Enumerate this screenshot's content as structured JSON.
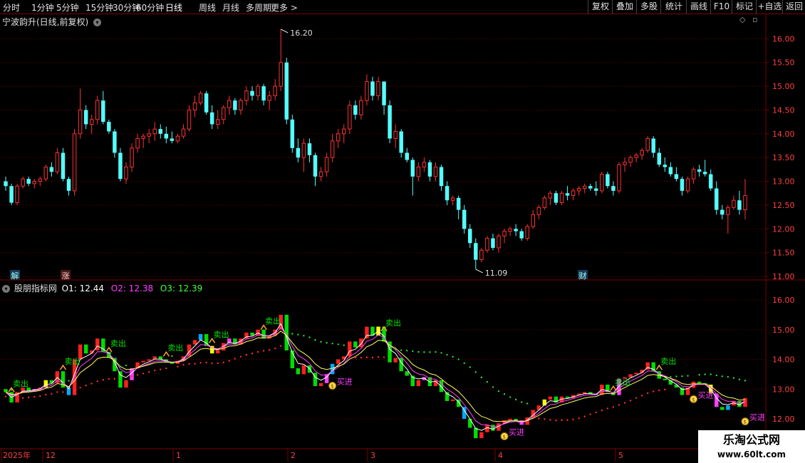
{
  "toolbar": {
    "periods": [
      "分时",
      "1分钟",
      "5分钟",
      "15分钟",
      "30分钟",
      "60分钟",
      "日线",
      "周线",
      "月线",
      "多周期",
      "更多 >"
    ],
    "active_period": "日线",
    "right_buttons": [
      "复权",
      "叠加",
      "多股",
      "统计",
      "画线",
      "F10",
      "标记",
      "+自选",
      "返回"
    ]
  },
  "main_chart": {
    "title": "宁波韵升(日线,前复权)",
    "high_label": "16.20",
    "low_label": "11.09",
    "y_ticks": [
      "16.00",
      "15.50",
      "15.00",
      "14.50",
      "14.00",
      "13.50",
      "13.00",
      "12.50",
      "12.00",
      "11.50",
      "11.00"
    ],
    "markers": [
      "解",
      "涨",
      "财"
    ]
  },
  "sub_chart": {
    "title": "股朋指标网",
    "o1_label": "O1: 12.44",
    "o2_label": "O2: 12.38",
    "o3_label": "O3: 12.39",
    "y_ticks": [
      "16.00",
      "15.00",
      "14.00",
      "13.00",
      "12.00"
    ],
    "buy_label": "买进",
    "sell_label": "卖出"
  },
  "time_axis": {
    "labels": [
      "2025年",
      "12",
      "1",
      "2",
      "3",
      "4",
      "5"
    ]
  },
  "watermark": {
    "line1": "乐淘公式网",
    "line2": "www.60lt.com"
  },
  "colors": {
    "up": "#ff3232",
    "down": "#54ffff",
    "grid": "#7a0000",
    "sell": "#00e000",
    "buy": "#ff40ff"
  },
  "chart_data": {
    "type": "candlestick",
    "ylim": [
      11.0,
      16.2
    ],
    "high": 16.2,
    "low": 11.09,
    "candles": [
      [
        13.0,
        13.1,
        12.8,
        12.9
      ],
      [
        12.9,
        12.95,
        12.5,
        12.55
      ],
      [
        12.55,
        12.95,
        12.5,
        12.9
      ],
      [
        12.9,
        13.1,
        12.85,
        13.05
      ],
      [
        13.05,
        13.1,
        12.9,
        12.95
      ],
      [
        12.95,
        13.05,
        12.85,
        13.0
      ],
      [
        13.0,
        13.1,
        12.9,
        13.05
      ],
      [
        13.05,
        13.35,
        13.0,
        13.3
      ],
      [
        13.3,
        13.4,
        13.1,
        13.2
      ],
      [
        13.2,
        13.7,
        13.15,
        13.6
      ],
      [
        13.6,
        13.7,
        13.0,
        13.05
      ],
      [
        13.05,
        13.1,
        12.7,
        12.8
      ],
      [
        12.8,
        14.1,
        12.7,
        14.0
      ],
      [
        14.0,
        14.95,
        13.9,
        14.5
      ],
      [
        14.5,
        14.6,
        14.1,
        14.2
      ],
      [
        14.2,
        14.4,
        14.0,
        14.3
      ],
      [
        14.3,
        14.8,
        14.2,
        14.7
      ],
      [
        14.7,
        14.9,
        14.2,
        14.25
      ],
      [
        14.25,
        14.3,
        14.0,
        14.05
      ],
      [
        14.05,
        14.1,
        13.5,
        13.6
      ],
      [
        13.6,
        13.7,
        13.0,
        13.05
      ],
      [
        13.05,
        13.4,
        12.95,
        13.3
      ],
      [
        13.3,
        13.8,
        13.2,
        13.7
      ],
      [
        13.7,
        14.0,
        13.6,
        13.9
      ],
      [
        13.9,
        14.0,
        13.7,
        13.95
      ],
      [
        13.95,
        14.1,
        13.8,
        14.0
      ],
      [
        14.0,
        14.25,
        13.85,
        14.1
      ],
      [
        14.1,
        14.2,
        13.9,
        14.0
      ],
      [
        14.0,
        14.15,
        13.8,
        13.9
      ],
      [
        13.9,
        14.05,
        13.8,
        13.85
      ],
      [
        13.85,
        14.0,
        13.8,
        13.95
      ],
      [
        13.95,
        14.2,
        13.9,
        14.1
      ],
      [
        14.1,
        14.6,
        14.05,
        14.5
      ],
      [
        14.5,
        14.8,
        14.35,
        14.65
      ],
      [
        14.65,
        14.9,
        14.6,
        14.85
      ],
      [
        14.85,
        14.9,
        14.4,
        14.45
      ],
      [
        14.45,
        14.6,
        14.1,
        14.2
      ],
      [
        14.2,
        14.5,
        14.1,
        14.3
      ],
      [
        14.3,
        14.6,
        14.2,
        14.55
      ],
      [
        14.55,
        14.8,
        14.4,
        14.7
      ],
      [
        14.7,
        14.75,
        14.4,
        14.5
      ],
      [
        14.5,
        14.75,
        14.4,
        14.7
      ],
      [
        14.7,
        15.0,
        14.6,
        14.9
      ],
      [
        14.9,
        15.0,
        14.7,
        14.8
      ],
      [
        14.8,
        15.05,
        14.7,
        15.0
      ],
      [
        15.0,
        15.05,
        14.6,
        14.7
      ],
      [
        14.7,
        14.9,
        14.5,
        14.8
      ],
      [
        14.8,
        15.15,
        14.7,
        15.0
      ],
      [
        15.0,
        16.2,
        14.9,
        15.5
      ],
      [
        15.5,
        15.6,
        14.2,
        14.3
      ],
      [
        14.3,
        14.4,
        13.6,
        13.7
      ],
      [
        13.7,
        13.9,
        13.4,
        13.5
      ],
      [
        13.5,
        13.9,
        13.2,
        13.8
      ],
      [
        13.8,
        13.9,
        13.4,
        13.55
      ],
      [
        13.55,
        13.6,
        12.9,
        13.1
      ],
      [
        13.1,
        13.3,
        13.0,
        13.2
      ],
      [
        13.2,
        13.6,
        13.1,
        13.5
      ],
      [
        13.5,
        14.0,
        13.4,
        13.85
      ],
      [
        13.85,
        14.1,
        13.7,
        14.0
      ],
      [
        14.0,
        14.2,
        13.8,
        14.1
      ],
      [
        14.1,
        14.7,
        14.0,
        14.6
      ],
      [
        14.6,
        14.7,
        14.3,
        14.4
      ],
      [
        14.4,
        14.8,
        14.3,
        14.7
      ],
      [
        14.7,
        15.25,
        14.6,
        15.1
      ],
      [
        15.1,
        15.2,
        14.7,
        14.8
      ],
      [
        14.8,
        15.2,
        14.7,
        15.1
      ],
      [
        15.1,
        15.0,
        14.4,
        14.6
      ],
      [
        14.6,
        14.7,
        13.8,
        13.9
      ],
      [
        13.9,
        14.2,
        13.7,
        14.05
      ],
      [
        14.05,
        14.1,
        13.5,
        13.6
      ],
      [
        13.6,
        13.7,
        13.4,
        13.45
      ],
      [
        13.45,
        13.5,
        12.7,
        13.1
      ],
      [
        13.1,
        13.4,
        13.0,
        13.3
      ],
      [
        13.3,
        13.5,
        13.2,
        13.4
      ],
      [
        13.4,
        13.45,
        13.0,
        13.1
      ],
      [
        13.1,
        13.4,
        13.0,
        13.3
      ],
      [
        13.3,
        13.35,
        12.8,
        12.9
      ],
      [
        12.9,
        13.0,
        12.5,
        12.6
      ],
      [
        12.6,
        12.7,
        12.5,
        12.65
      ],
      [
        12.65,
        12.7,
        12.2,
        12.4
      ],
      [
        12.4,
        12.5,
        11.9,
        12.0
      ],
      [
        12.0,
        12.1,
        11.6,
        11.7
      ],
      [
        11.7,
        11.8,
        11.15,
        11.35
      ],
      [
        11.35,
        11.6,
        11.3,
        11.55
      ],
      [
        11.55,
        11.85,
        11.5,
        11.8
      ],
      [
        11.8,
        11.9,
        11.55,
        11.6
      ],
      [
        11.6,
        11.9,
        11.5,
        11.85
      ],
      [
        11.85,
        12.0,
        11.7,
        11.95
      ],
      [
        11.95,
        12.05,
        11.85,
        12.0
      ],
      [
        12.0,
        12.1,
        11.85,
        11.95
      ],
      [
        11.95,
        12.0,
        11.75,
        11.8
      ],
      [
        11.8,
        12.1,
        11.75,
        12.05
      ],
      [
        12.05,
        12.4,
        12.0,
        12.3
      ],
      [
        12.3,
        12.5,
        12.2,
        12.45
      ],
      [
        12.45,
        12.7,
        12.4,
        12.65
      ],
      [
        12.65,
        12.8,
        12.5,
        12.75
      ],
      [
        12.75,
        12.8,
        12.5,
        12.55
      ],
      [
        12.55,
        12.8,
        12.5,
        12.75
      ],
      [
        12.75,
        12.9,
        12.6,
        12.7
      ],
      [
        12.7,
        12.85,
        12.6,
        12.8
      ],
      [
        12.8,
        12.9,
        12.7,
        12.85
      ],
      [
        12.85,
        12.95,
        12.75,
        12.9
      ],
      [
        12.9,
        12.95,
        12.8,
        12.85
      ],
      [
        12.85,
        13.0,
        12.7,
        12.8
      ],
      [
        12.8,
        13.2,
        12.75,
        13.15
      ],
      [
        13.15,
        13.2,
        12.85,
        12.9
      ],
      [
        12.9,
        13.0,
        12.7,
        12.8
      ],
      [
        12.8,
        13.4,
        12.75,
        13.35
      ],
      [
        13.35,
        13.5,
        13.2,
        13.4
      ],
      [
        13.4,
        13.55,
        13.3,
        13.5
      ],
      [
        13.5,
        13.6,
        13.4,
        13.55
      ],
      [
        13.55,
        13.7,
        13.45,
        13.65
      ],
      [
        13.65,
        13.95,
        13.6,
        13.9
      ],
      [
        13.9,
        13.95,
        13.5,
        13.6
      ],
      [
        13.6,
        13.7,
        13.3,
        13.35
      ],
      [
        13.35,
        13.5,
        13.2,
        13.3
      ],
      [
        13.3,
        13.4,
        13.1,
        13.15
      ],
      [
        13.15,
        13.3,
        13.0,
        13.05
      ],
      [
        13.05,
        13.1,
        12.7,
        12.8
      ],
      [
        12.8,
        13.1,
        12.75,
        13.05
      ],
      [
        13.05,
        13.3,
        12.95,
        13.25
      ],
      [
        13.25,
        13.35,
        13.1,
        13.2
      ],
      [
        13.2,
        13.45,
        13.1,
        13.15
      ],
      [
        13.15,
        13.25,
        12.8,
        12.85
      ],
      [
        12.85,
        13.0,
        12.3,
        12.4
      ],
      [
        12.4,
        12.5,
        12.2,
        12.3
      ],
      [
        12.3,
        12.5,
        11.9,
        12.45
      ],
      [
        12.45,
        12.7,
        12.4,
        12.6
      ],
      [
        12.6,
        12.8,
        12.3,
        12.4
      ],
      [
        12.4,
        13.05,
        12.2,
        12.7
      ]
    ]
  }
}
